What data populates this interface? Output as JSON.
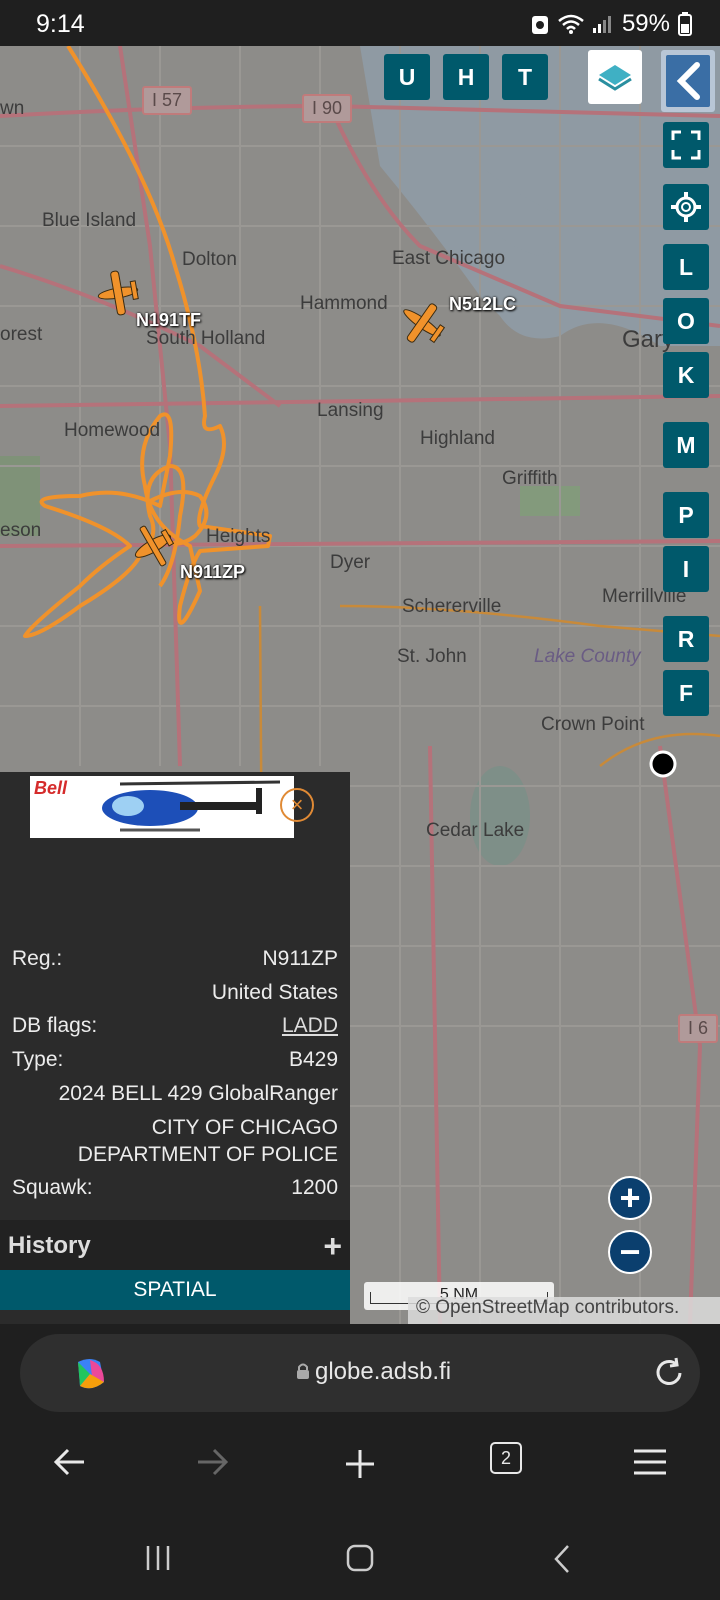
{
  "status_bar": {
    "time": "9:14",
    "battery": "59%"
  },
  "map": {
    "highways": [
      "I 57",
      "I 90",
      "I 6"
    ],
    "places": [
      "Blue Island",
      "Dolton",
      "East Chicago",
      "Hammond",
      "South Holland",
      "orest",
      "Gary",
      "Lansing",
      "Homewood",
      "Highland",
      "Griffith",
      "eson",
      "Heights",
      "Dyer",
      "Schererville",
      "Merrillville",
      "St. John",
      "Lake County",
      "Crown Point",
      "Cedar Lake",
      "wn"
    ],
    "aircraft": [
      {
        "callsign": "N191TF"
      },
      {
        "callsign": "N512LC"
      },
      {
        "callsign": "N911ZP"
      }
    ]
  },
  "toolbar": {
    "buttons": [
      "U",
      "H",
      "T"
    ]
  },
  "side_buttons": [
    "L",
    "O",
    "K",
    "M",
    "P",
    "I",
    "R",
    "F"
  ],
  "info": {
    "reg_label": "Reg.:",
    "reg_value": "N911ZP",
    "country": "United States",
    "db_flags_label": "DB flags:",
    "db_flags_value": "LADD",
    "type_label": "Type:",
    "type_value": "B429",
    "model": "2024 BELL 429 GlobalRanger",
    "owner_line1": "CITY OF CHICAGO",
    "owner_line2": "DEPARTMENT OF POLICE",
    "squawk_label": "Squawk:",
    "squawk_value": "1200",
    "photo_brand": "Bell"
  },
  "history": {
    "label": "History",
    "spatial": "SPATIAL"
  },
  "scale": "5 NM",
  "attribution": "© OpenStreetMap contributors.",
  "browser": {
    "url": "globe.adsb.fi",
    "tab_count": "2"
  },
  "colors": {
    "button_bg": "#00596b",
    "track": "#f0922b",
    "zoom_bg": "#0b3f6e"
  }
}
